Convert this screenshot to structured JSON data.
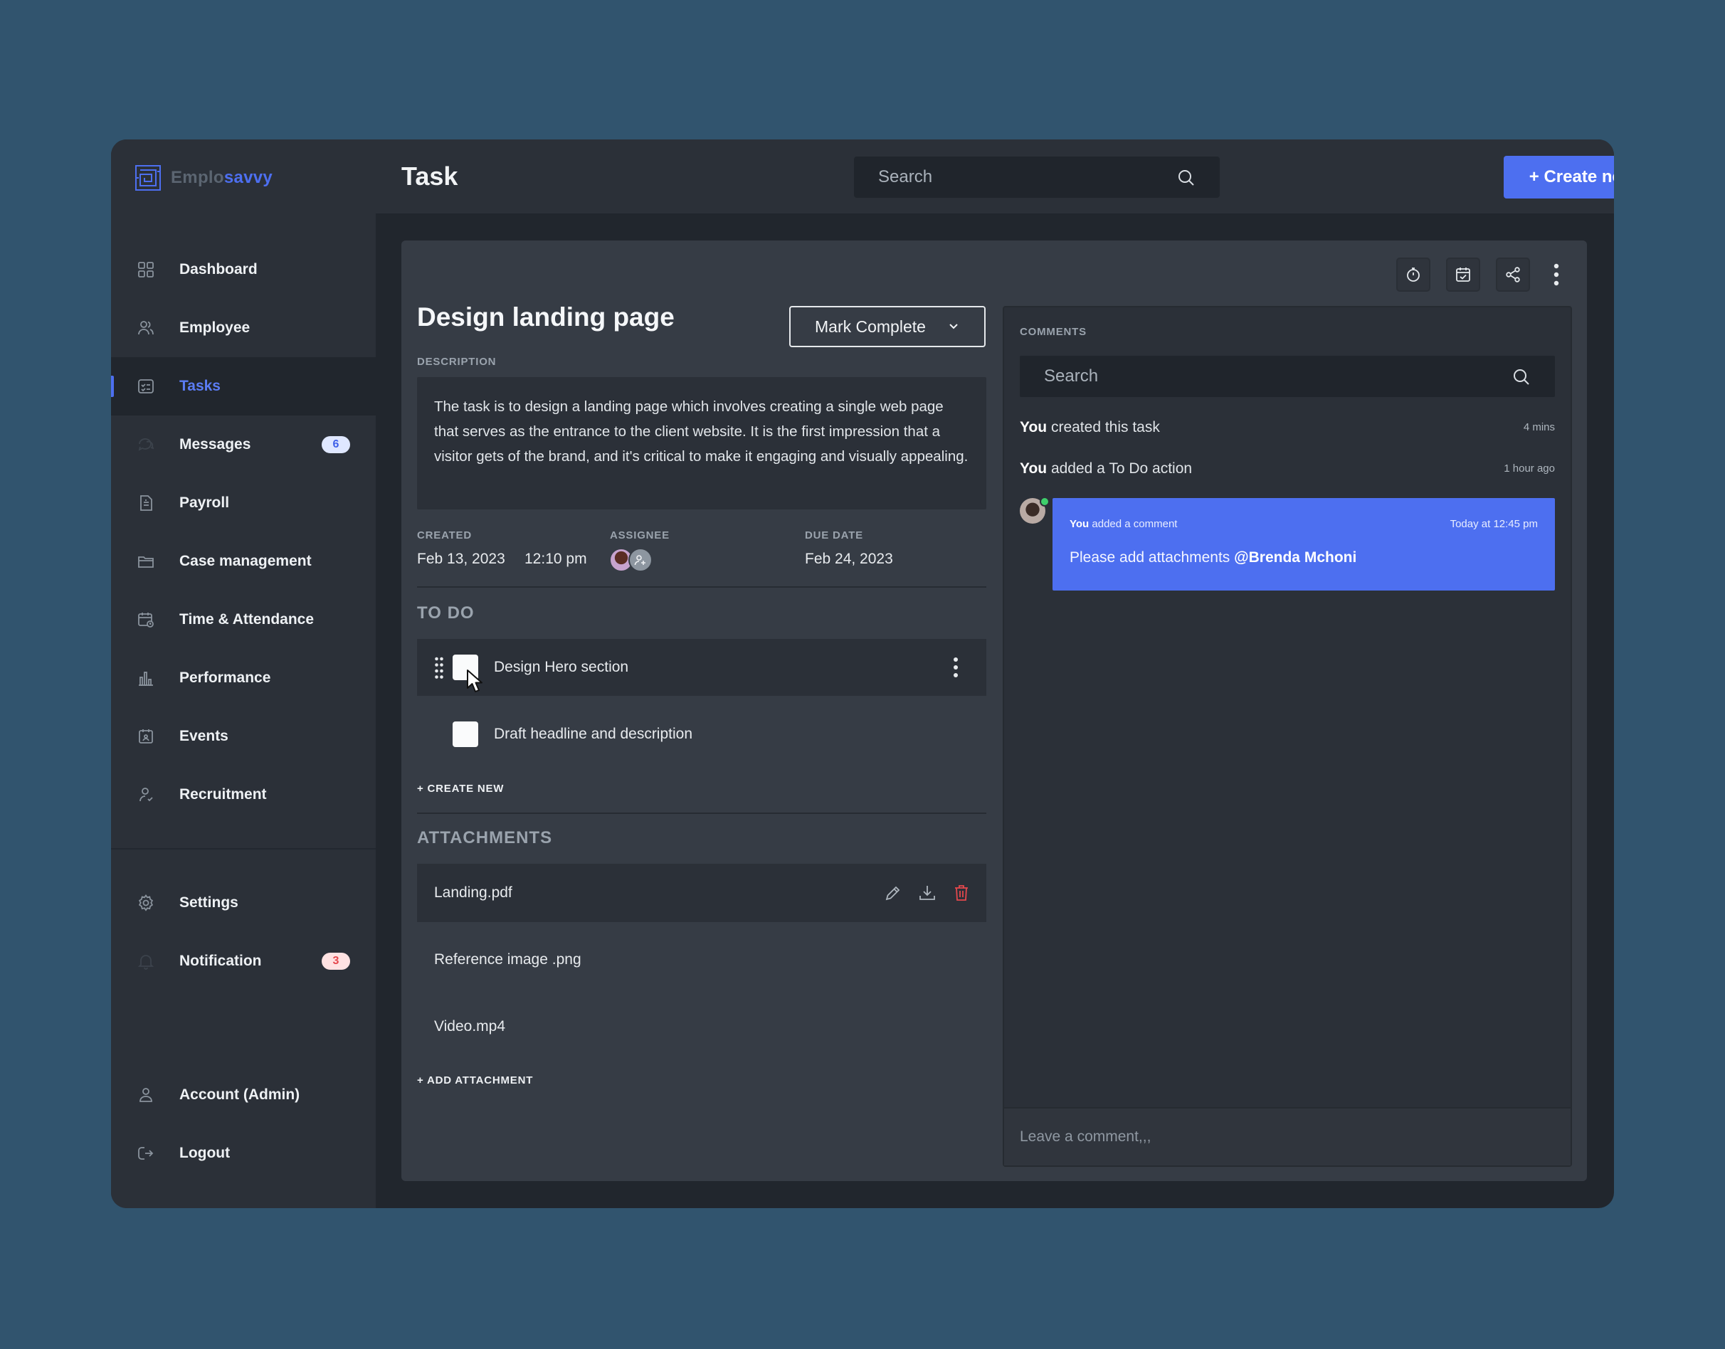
{
  "brand": {
    "part1": "Emplo",
    "part2": "savvy"
  },
  "sidebar": {
    "items": [
      {
        "label": "Dashboard",
        "icon": "grid-icon"
      },
      {
        "label": "Employee",
        "icon": "users-icon"
      },
      {
        "label": "Tasks",
        "icon": "task-icon",
        "active": true
      },
      {
        "label": "Messages",
        "icon": "chat-icon",
        "badge": "6"
      },
      {
        "label": "Payroll",
        "icon": "payroll-icon"
      },
      {
        "label": "Case management",
        "icon": "folder-icon"
      },
      {
        "label": "Time & Attendance",
        "icon": "calendar-clock-icon"
      },
      {
        "label": "Performance",
        "icon": "bar-chart-icon"
      },
      {
        "label": "Events",
        "icon": "event-icon"
      },
      {
        "label": "Recruitment",
        "icon": "recruit-icon"
      }
    ],
    "bottom": [
      {
        "label": "Settings",
        "icon": "gear-icon"
      },
      {
        "label": "Notification",
        "icon": "bell-icon",
        "badge": "3"
      },
      {
        "label": "Account (Admin)",
        "icon": "user-icon"
      },
      {
        "label": "Logout",
        "icon": "logout-icon"
      }
    ]
  },
  "header": {
    "title": "Task",
    "search_placeholder": "Search",
    "create_button": "+ Create new task"
  },
  "task": {
    "title": "Design landing page",
    "mark_complete": "Mark Complete",
    "description_label": "DESCRIPTION",
    "description": "The task is to design a landing page which involves creating a single web page that serves as the entrance to the client website. It is the first impression that a visitor gets of the brand, and it's critical to make it engaging and visually appealing.",
    "created_label": "CREATED",
    "created_date": "Feb 13, 2023",
    "created_time": "12:10 pm",
    "assignee_label": "ASSIGNEE",
    "due_label": "DUE DATE",
    "due_date": "Feb 24, 2023",
    "todo_heading": "TO DO",
    "todos": [
      "Design Hero section",
      "Draft headline and description"
    ],
    "create_new": "+ CREATE NEW",
    "attachments_heading": "ATTACHMENTS",
    "attachments": [
      "Landing.pdf",
      "Reference image .png",
      "Video.mp4"
    ],
    "add_attachment": "+ ADD ATTACHMENT"
  },
  "comments": {
    "label": "COMMENTS",
    "search_placeholder": "Search",
    "activity": [
      {
        "who": "You",
        "text": "created this task",
        "time": "4 mins"
      },
      {
        "who": "You",
        "text": "added a To Do action",
        "time": "1 hour ago"
      }
    ],
    "comment": {
      "who": "You",
      "action": "added a comment",
      "time": "Today at 12:45 pm",
      "message": "Please add attachments",
      "mention": "@Brenda Mchoni"
    },
    "input_placeholder": "Leave a comment,,,"
  },
  "colors": {
    "accent": "#4d6ff0",
    "background": "#31546e",
    "sidebar": "#2b3038",
    "panel": "#363c45",
    "danger": "#e5484d"
  }
}
